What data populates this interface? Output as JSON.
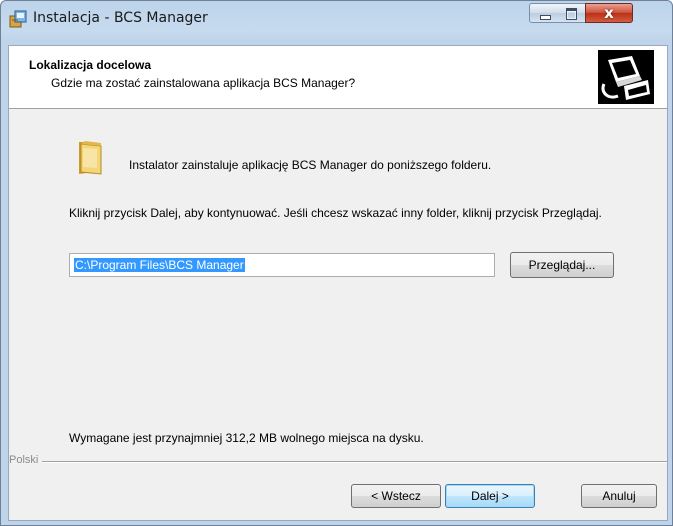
{
  "window": {
    "title": "Instalacja - BCS Manager",
    "icon": "installer-box-icon",
    "controls": [
      "minimize-icon",
      "maximize-icon",
      "close-icon"
    ],
    "close_glyph": "x"
  },
  "header": {
    "title": "Lokalizacja docelowa",
    "subtitle": "Gdzie ma zostać zainstalowana aplikacja BCS Manager?",
    "logo_icon": "computer-install-icon"
  },
  "body": {
    "folder_icon": "folder-icon",
    "intro": "Instalator zainstaluje aplikację BCS Manager do poniższego folderu.",
    "instruction": "Kliknij przycisk Dalej, aby kontynuować. Jeśli chcesz wskazać inny folder, kliknij przycisk Przeglądaj.",
    "path_value": "C:\\Program Files\\BCS Manager",
    "browse_label": "Przeglądaj...",
    "space_required": "Wymagane jest przynajmniej 312,2 MB wolnego miejsca na dysku."
  },
  "footer": {
    "language": "Polski",
    "back_label": "< Wstecz",
    "next_label": "Dalej >",
    "cancel_label": "Anuluj"
  },
  "colors": {
    "selection": "#3399ff",
    "close_button": "#c7452d",
    "frame": "#bfd4ea"
  }
}
